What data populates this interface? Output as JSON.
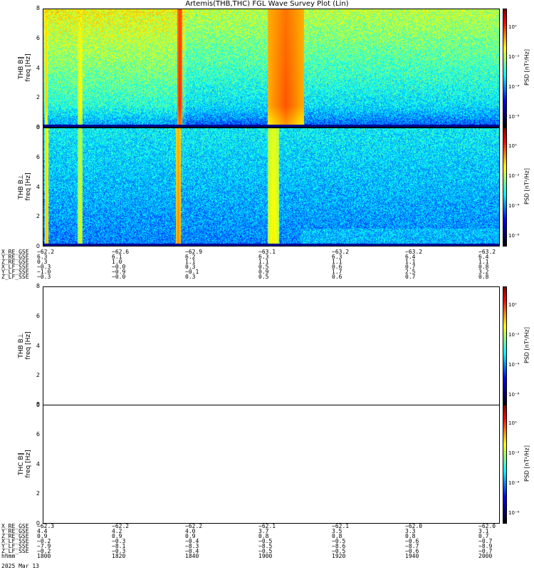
{
  "title": "Artemis(THB,THC) FGL Wave Survey Plot (Lin)",
  "chart_data": [
    {
      "type": "heatmap",
      "ylabel_lines": [
        "THB B∥",
        "freq [Hz]"
      ],
      "yticks": [
        "0",
        "2",
        "4",
        "6",
        "8"
      ],
      "ylim": [
        0,
        8
      ],
      "colorbar_label": "PSD [nT²/Hz]",
      "colorbar_ticks": [
        "10⁰",
        "10⁻²",
        "10⁻⁴",
        "10⁻⁶"
      ],
      "has_data": true
    },
    {
      "type": "heatmap",
      "ylabel_lines": [
        "THB B⊥",
        "freq [Hz]"
      ],
      "yticks": [
        "0",
        "2",
        "4",
        "6",
        "8"
      ],
      "ylim": [
        0,
        8
      ],
      "colorbar_label": "PSD [nT²/Hz]",
      "colorbar_ticks": [
        "10⁰",
        "10⁻²",
        "10⁻⁴",
        "10⁻⁶"
      ],
      "has_data": true
    },
    {
      "type": "heatmap",
      "ylabel_lines": [
        "THB B⊥",
        "freq [Hz]"
      ],
      "yticks": [
        "0",
        "2",
        "4",
        "6",
        "8"
      ],
      "ylim": [
        0,
        8
      ],
      "colorbar_label": "PSD [nT²/Hz]",
      "colorbar_ticks": [
        "10⁰",
        "10⁻²",
        "10⁻⁴",
        "10⁻⁶"
      ],
      "has_data": false
    },
    {
      "type": "heatmap",
      "ylabel_lines": [
        "THC B∥",
        "freq [Hz]"
      ],
      "yticks": [
        "0",
        "2",
        "4",
        "6",
        "8"
      ],
      "ylim": [
        0,
        8
      ],
      "colorbar_label": "PSD [nT²/Hz]",
      "colorbar_ticks": [
        "10⁰",
        "10⁻²",
        "10⁻⁴",
        "10⁻⁶"
      ],
      "has_data": false
    }
  ],
  "ephemeris_top": [
    {
      "label": "X_RE_GSE",
      "values": [
        "−62.2",
        "−62.6",
        "−62.9",
        "−63.1",
        "−63.2",
        "−63.2",
        "−63.2"
      ]
    },
    {
      "label": "Y_RE_GSE",
      "values": [
        "6.3",
        "6.1",
        "6.2",
        "6.3",
        "6.3",
        "6.4",
        "6.4"
      ]
    },
    {
      "label": "Z_RE_GSE",
      "values": [
        "0.3",
        "1.0",
        "1.1",
        "1.1",
        "1.1",
        "1.1",
        "1.1"
      ]
    },
    {
      "label": "X_LF_SSE",
      "values": [
        "−0.3",
        "−0.0",
        "0.3",
        "0.5",
        "0.6",
        "0.7",
        "0.8"
      ]
    },
    {
      "label": "Y_LF_SSE",
      "values": [
        "−1.0",
        "−0.9",
        "−0.1",
        "0.9",
        "1.7",
        "2.5",
        "3.2"
      ]
    },
    {
      "label": "Z_LF_SSE",
      "values": [
        "−0.3",
        "−0.0",
        "0.3",
        "0.5",
        "0.6",
        "0.7",
        "0.8"
      ]
    }
  ],
  "ephemeris_bottom": [
    {
      "label": "X_RE_GSE",
      "values": [
        "−62.3",
        "−62.2",
        "−62.2",
        "−62.1",
        "−62.1",
        "−62.0",
        "−62.0"
      ]
    },
    {
      "label": "Y_RE_GSE",
      "values": [
        "4.4",
        "4.2",
        "4.0",
        "3.7",
        "3.5",
        "3.3",
        "3.1"
      ]
    },
    {
      "label": "Z_RE_GSE",
      "values": [
        "0.9",
        "0.9",
        "0.9",
        "0.8",
        "0.8",
        "0.8",
        "0.7"
      ]
    },
    {
      "label": "X_LF_SSE",
      "values": [
        "−0.2",
        "−0.3",
        "−0.4",
        "−0.5",
        "−0.5",
        "−0.6",
        "−0.7"
      ]
    },
    {
      "label": "Y_LF_SSE",
      "values": [
        "−7.9",
        "−8.1",
        "−8.3",
        "−8.5",
        "−8.6",
        "−8.7",
        "−8.9"
      ]
    },
    {
      "label": "Z_LF_SSE",
      "values": [
        "−0.2",
        "−0.3",
        "−0.4",
        "−0.5",
        "−0.5",
        "−0.6",
        "−0.7"
      ]
    },
    {
      "label": "hhmm",
      "values": [
        "1800",
        "1820",
        "1840",
        "1900",
        "1920",
        "1940",
        "2000"
      ]
    }
  ],
  "date_label": "2025 Mar 13"
}
